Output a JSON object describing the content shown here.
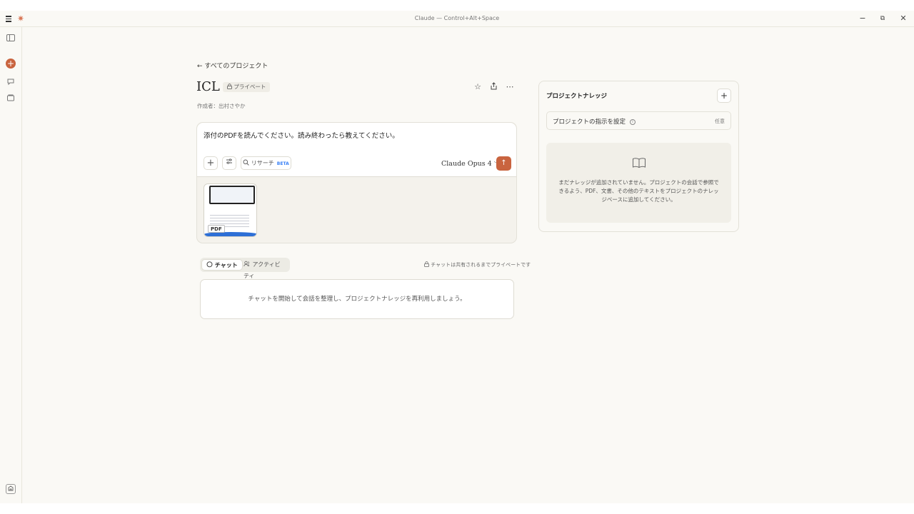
{
  "window": {
    "title": "Claude — Control+Alt+Space",
    "logo": "✷",
    "controls": {
      "minimize": "−",
      "restore": "⧉",
      "close": "✕"
    }
  },
  "header": {
    "back_label": "← すべてのプロジェクト",
    "project_title": "ICL",
    "visibility_badge": "プライベート",
    "author": "作成者：出村さやか",
    "icons": [
      "star-icon",
      "share-icon",
      "more-icon"
    ]
  },
  "composer": {
    "prompt_text": "添付のPDFを読んでください。読み終わったら教えてください。",
    "research_label": "リサーチ",
    "research_badge": "BETA",
    "model_label": "Claude Opus 4",
    "attachment": {
      "type_label": "PDF"
    }
  },
  "tabs": [
    {
      "label": "チャット",
      "active": true
    },
    {
      "label": "アクティビティ",
      "active": false
    }
  ],
  "private_note": "チャットは共有されるまでプライベートです",
  "chat_empty_text": "チャットを開始して会話を整理し、プロジェクトナレッジを再利用しましょう。",
  "knowledge": {
    "title": "プロジェクトナレッジ",
    "instructions_label": "プロジェクトの指示を設定",
    "instructions_optional": "任意",
    "empty_text": "まだナレッジが追加されていません。プロジェクトの会話で参照できるよう、PDF、文書、その他のテキストをプロジェクトのナレッジベースに追加してください。"
  },
  "colors": {
    "accent": "#c9643f",
    "background": "#faf9f5",
    "beta": "#3b82f6"
  }
}
